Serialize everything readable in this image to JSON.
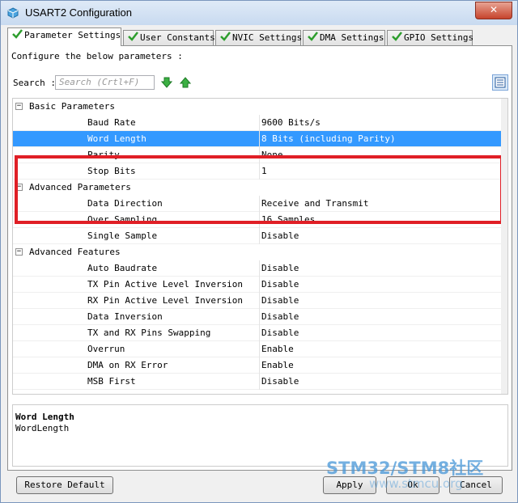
{
  "window": {
    "title": "USART2 Configuration",
    "close_symbol": "✕"
  },
  "tabs": [
    {
      "label": "Parameter Settings",
      "active": true
    },
    {
      "label": "User Constants",
      "active": false
    },
    {
      "label": "NVIC Settings",
      "active": false
    },
    {
      "label": "DMA Settings",
      "active": false
    },
    {
      "label": "GPIO Settings",
      "active": false
    }
  ],
  "panel": {
    "instruction": "Configure the below parameters :"
  },
  "search": {
    "label": "Search :",
    "placeholder": "Search (Crtl+F)"
  },
  "groups": {
    "basic": {
      "label": "Basic Parameters",
      "toggle": "−"
    },
    "advanced_params": {
      "label": "Advanced Parameters",
      "toggle": "−"
    },
    "advanced_features": {
      "label": "Advanced Features",
      "toggle": "−"
    }
  },
  "params": {
    "baud_rate": {
      "name": "Baud Rate",
      "value": "9600 Bits/s"
    },
    "word_length": {
      "name": "Word Length",
      "value": "8 Bits (including Parity)"
    },
    "parity": {
      "name": "Parity",
      "value": "None"
    },
    "stop_bits": {
      "name": "Stop Bits",
      "value": "1"
    },
    "data_direction": {
      "name": "Data Direction",
      "value": "Receive and Transmit"
    },
    "over_sampling": {
      "name": "Over Sampling",
      "value": "16 Samples"
    },
    "single_sample": {
      "name": "Single Sample",
      "value": "Disable"
    },
    "auto_baudrate": {
      "name": "Auto Baudrate",
      "value": "Disable"
    },
    "tx_pin_inversion": {
      "name": "TX Pin Active Level Inversion",
      "value": "Disable"
    },
    "rx_pin_inversion": {
      "name": "RX Pin Active Level Inversion",
      "value": "Disable"
    },
    "data_inversion": {
      "name": "Data Inversion",
      "value": "Disable"
    },
    "tx_rx_swap": {
      "name": "TX and RX Pins Swapping",
      "value": "Disable"
    },
    "overrun": {
      "name": "Overrun",
      "value": "Enable"
    },
    "dma_on_rx_error": {
      "name": "DMA on RX Error",
      "value": "Enable"
    },
    "msb_first": {
      "name": "MSB First",
      "value": "Disable"
    }
  },
  "selected_param": "word_length",
  "description": {
    "title": "Word Length",
    "text": "WordLength"
  },
  "buttons": {
    "restore": "Restore Default",
    "apply": "Apply",
    "ok": "Ok",
    "cancel": "Cancel"
  },
  "watermark": {
    "brand": "STM32/STM8社区",
    "url": "www.stmcu.org"
  },
  "colors": {
    "selection": "#3399ff",
    "highlight_box": "#e01f26",
    "accent_green": "#2e9e2e"
  }
}
